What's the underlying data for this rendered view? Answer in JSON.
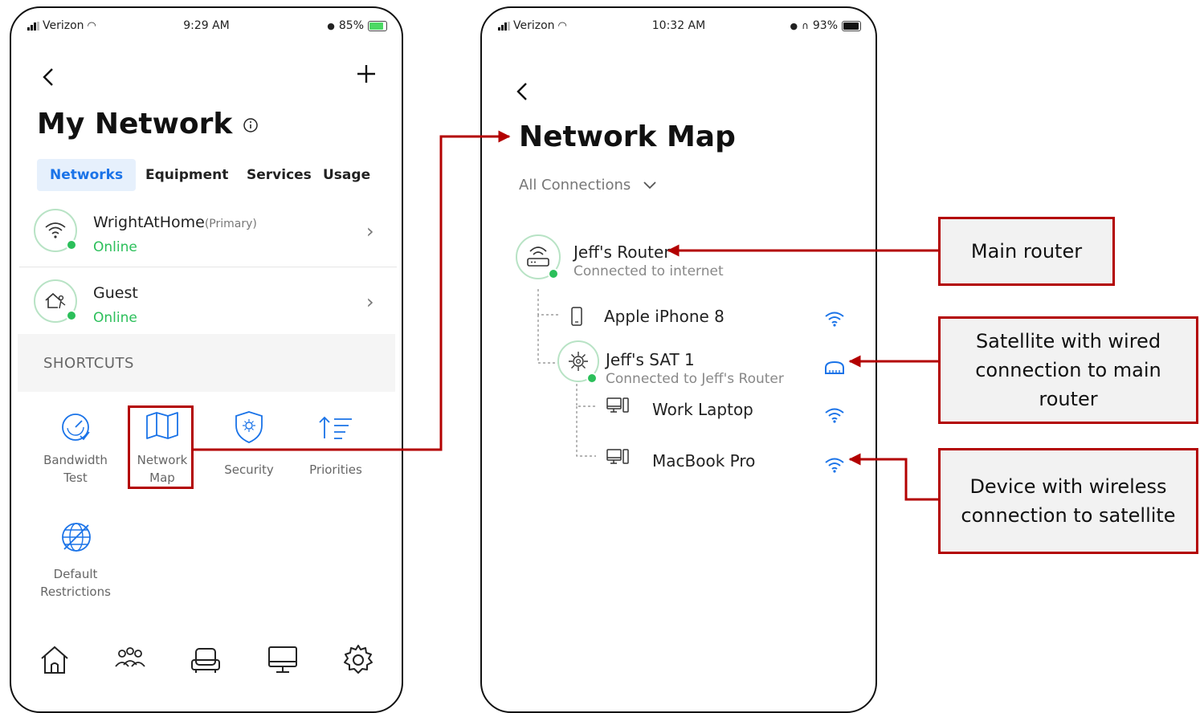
{
  "left_phone": {
    "status": {
      "carrier": "Verizon",
      "time": "9:29 AM",
      "battery": "85%"
    },
    "title": "My Network",
    "tabs": [
      "Networks",
      "Equipment",
      "Services",
      "Usage"
    ],
    "networks": [
      {
        "name": "WrightAtHome",
        "tag": "(Primary)",
        "status": "Online"
      },
      {
        "name": "Guest",
        "tag": "",
        "status": "Online"
      }
    ],
    "shortcuts_header": "SHORTCUTS",
    "shortcuts": {
      "bandwidth": {
        "line1": "Bandwidth",
        "line2": "Test"
      },
      "map": {
        "line1": "Network",
        "line2": "Map"
      },
      "security": {
        "line1": "Security"
      },
      "priorities": {
        "line1": "Priorities"
      },
      "restrictions": {
        "line1": "Default",
        "line2": "Restrictions"
      }
    },
    "bottom_nav": [
      "home-icon",
      "people-icon",
      "couch-icon",
      "monitor-icon",
      "settings-icon"
    ]
  },
  "right_phone": {
    "status": {
      "carrier": "Verizon",
      "time": "10:32 AM",
      "battery": "93%"
    },
    "title": "Network Map",
    "filter": "All Connections",
    "router": {
      "name": "Jeff's Router",
      "sub": "Connected to internet"
    },
    "devices": {
      "iphone": {
        "name": "Apple iPhone 8",
        "connection": "wifi"
      },
      "sat": {
        "name": "Jeff's SAT 1",
        "sub": "Connected to Jeff's Router",
        "connection": "wired"
      },
      "laptop": {
        "name": "Work Laptop",
        "connection": "wifi"
      },
      "macbook": {
        "name": "MacBook Pro",
        "connection": "wifi"
      }
    }
  },
  "callouts": {
    "main_router": "Main router",
    "satellite": "Satellite with wired connection to main router",
    "device": "Device with wireless connection to satellite"
  },
  "colors": {
    "accent": "#1a73e8",
    "online": "#2bbf5a",
    "annotation": "#b30000"
  }
}
